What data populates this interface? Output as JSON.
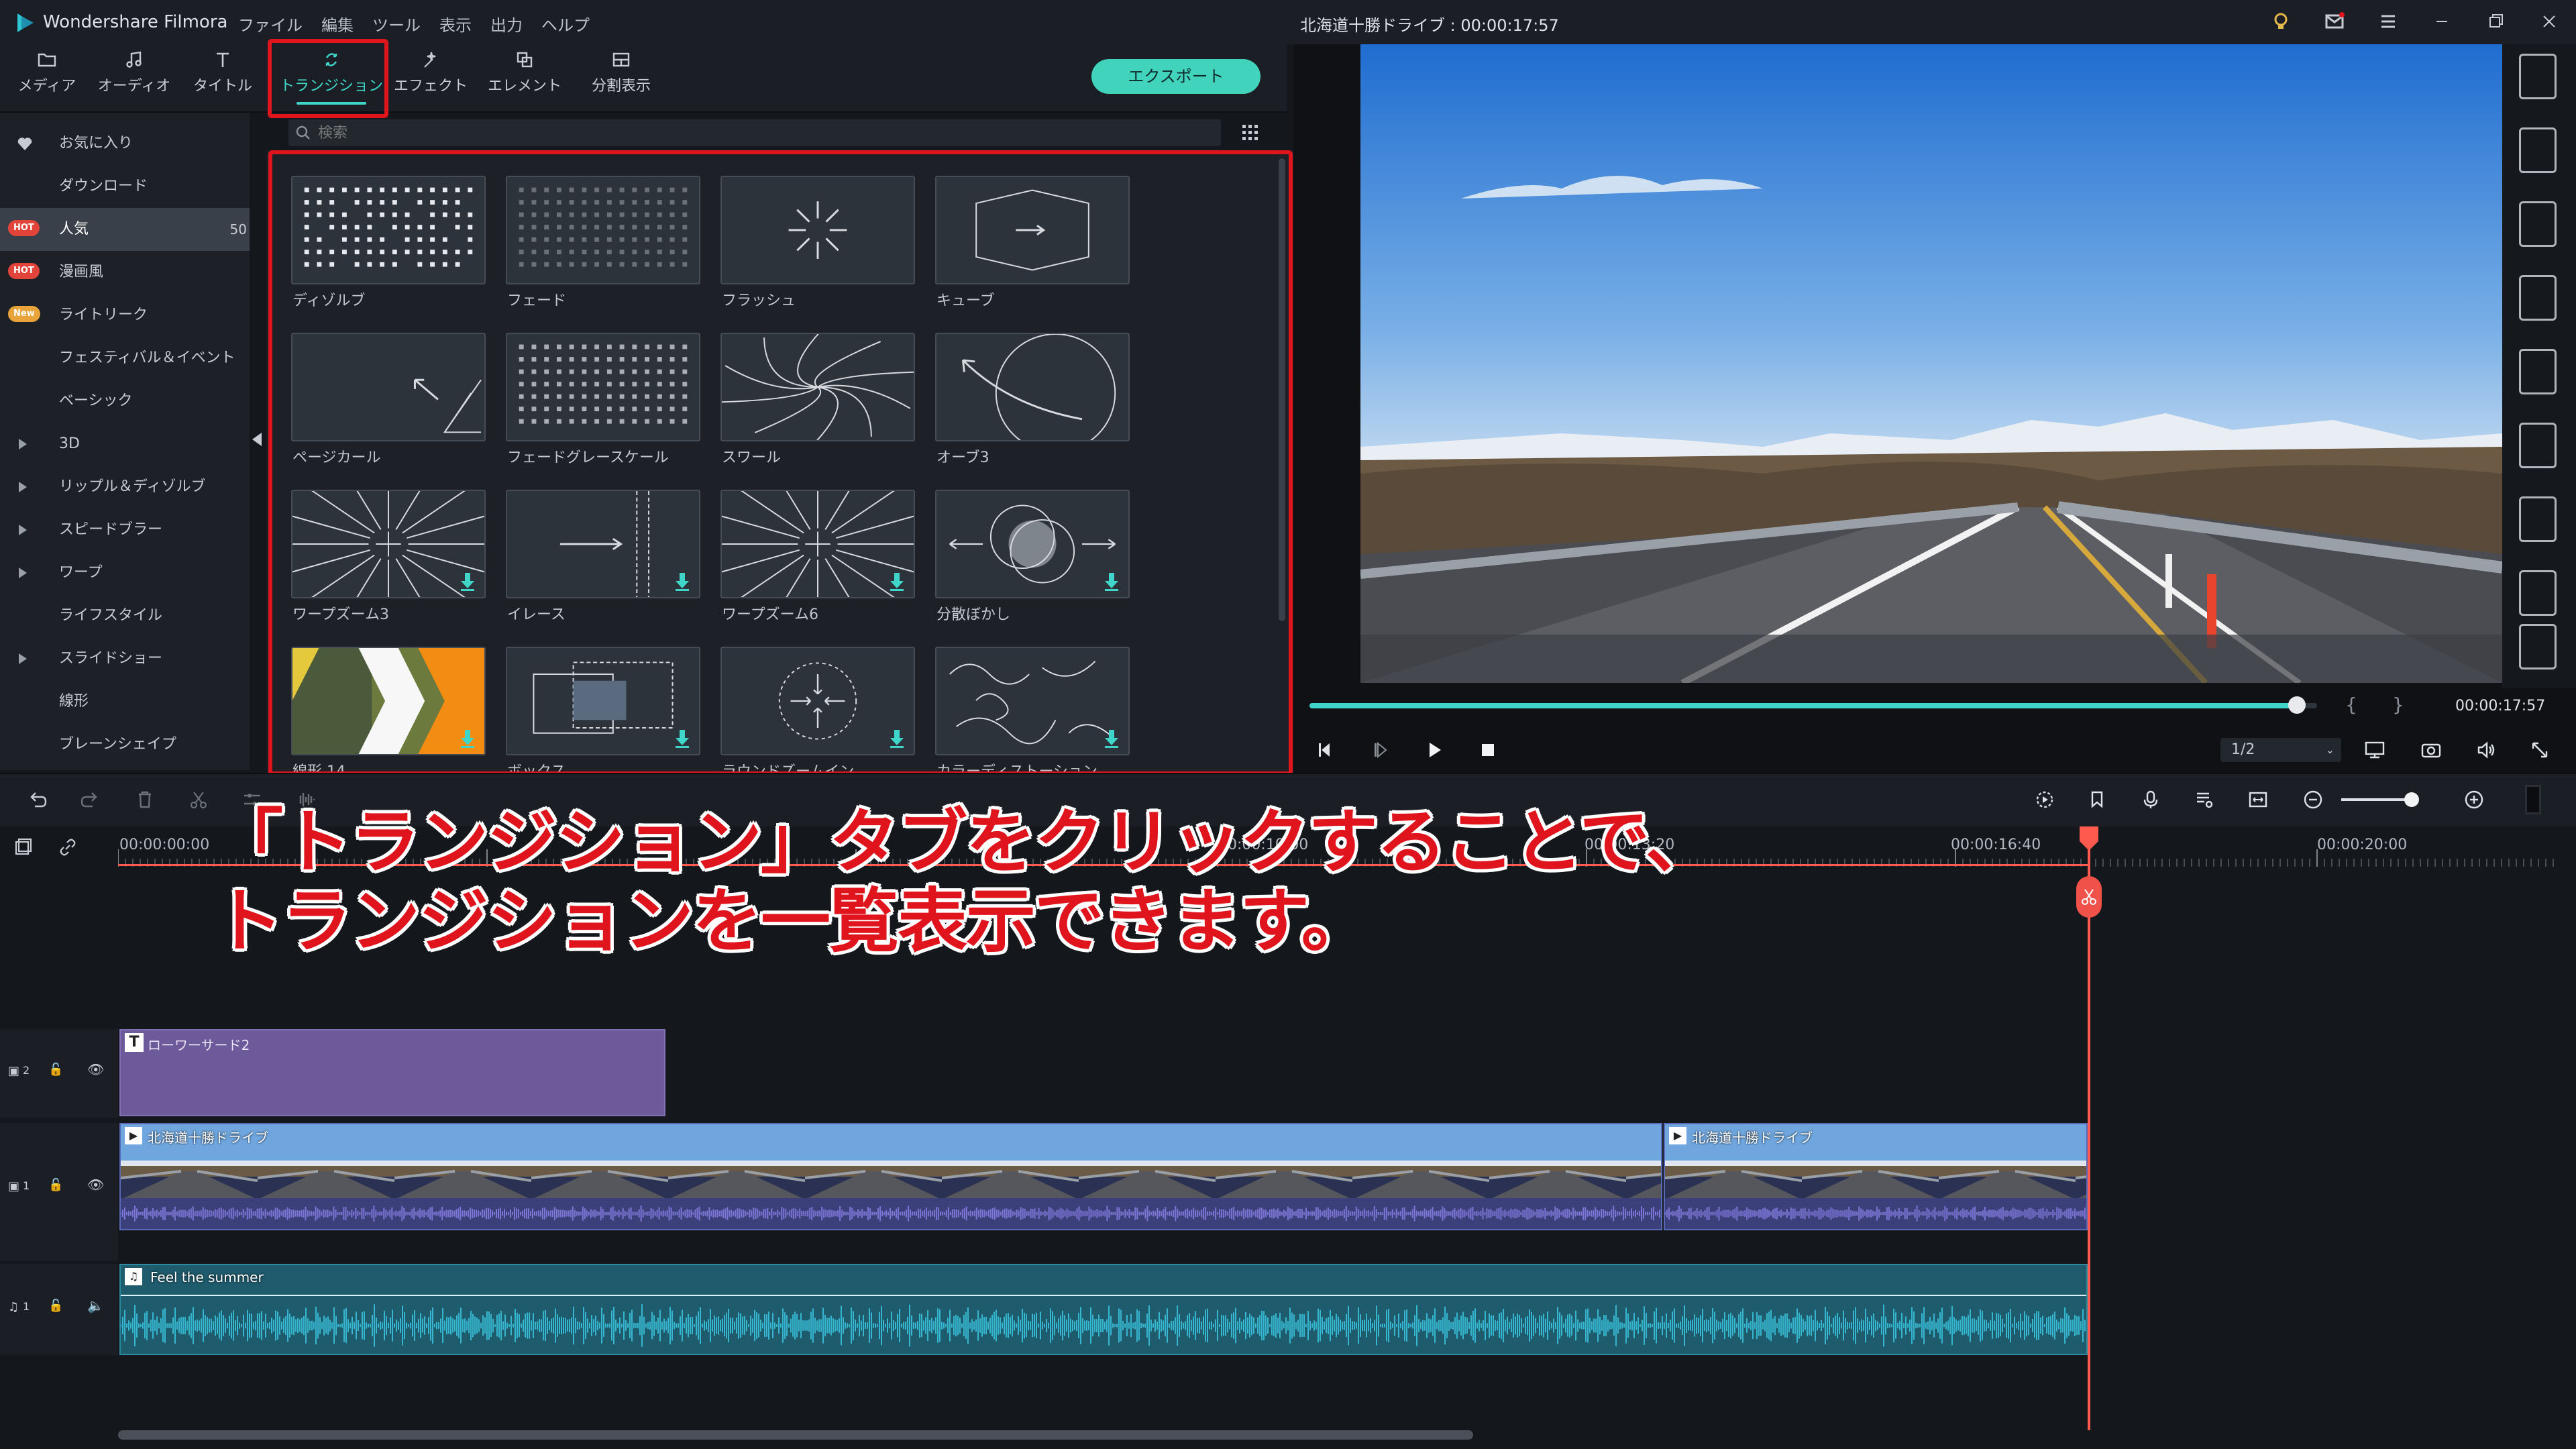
{
  "app": {
    "name": "Wondershare Filmora",
    "menu": [
      "ファイル",
      "編集",
      "ツール",
      "表示",
      "出力",
      "ヘルプ"
    ],
    "document_title": "北海道十勝ドライブ : 00:00:17:57"
  },
  "toolbar": {
    "tabs": [
      {
        "label": "メディア",
        "icon": "folder-icon"
      },
      {
        "label": "オーディオ",
        "icon": "music-note-icon"
      },
      {
        "label": "タイトル",
        "icon": "text-t-icon"
      },
      {
        "label": "トランジション",
        "icon": "transition-icon",
        "active": true
      },
      {
        "label": "エフェクト",
        "icon": "magic-icon"
      },
      {
        "label": "エレメント",
        "icon": "element-icon"
      },
      {
        "label": "分割表示",
        "icon": "split-screen-icon"
      }
    ],
    "export_label": "エクスポート",
    "accent_color": "#3fd5c8",
    "export_color": "#42d3bd"
  },
  "sidebar": {
    "items": [
      {
        "label": "お気に入り",
        "icon": "heart-icon"
      },
      {
        "label": "ダウンロード"
      },
      {
        "label": "人気",
        "badge": "HOT",
        "selected": true,
        "count": "50"
      },
      {
        "label": "漫画風",
        "badge": "HOT"
      },
      {
        "label": "ライトリーク",
        "badge": "New"
      },
      {
        "label": "フェスティバル＆イベント"
      },
      {
        "label": "ベーシック"
      },
      {
        "label": "3D",
        "expandable": true
      },
      {
        "label": "リップル＆ディゾルブ",
        "expandable": true
      },
      {
        "label": "スピードブラー",
        "expandable": true
      },
      {
        "label": "ワープ",
        "expandable": true
      },
      {
        "label": "ライフスタイル"
      },
      {
        "label": "スライドショー",
        "expandable": true
      },
      {
        "label": "線形"
      },
      {
        "label": "ブレーンシェイプ"
      }
    ]
  },
  "search": {
    "placeholder": "検索"
  },
  "transitions": [
    {
      "name": "ディゾルブ",
      "pattern": "dissolve"
    },
    {
      "name": "フェード",
      "pattern": "fade"
    },
    {
      "name": "フラッシュ",
      "pattern": "flash"
    },
    {
      "name": "キューブ",
      "pattern": "cube"
    },
    {
      "name": "ページカール",
      "pattern": "pagecurl"
    },
    {
      "name": "フェードグレースケール",
      "pattern": "fadegray"
    },
    {
      "name": "スワール",
      "pattern": "swirl"
    },
    {
      "name": "オーブ3",
      "pattern": "orb"
    },
    {
      "name": "ワープズーム3",
      "pattern": "warpzoom",
      "download": true
    },
    {
      "name": "イレース",
      "pattern": "erase",
      "download": true
    },
    {
      "name": "ワープズーム6",
      "pattern": "warpzoom6",
      "download": true
    },
    {
      "name": "分散ぼかし",
      "pattern": "scatter",
      "download": true
    },
    {
      "name": "線形 14",
      "pattern": "chevron",
      "download": true
    },
    {
      "name": "ボックス",
      "pattern": "box",
      "download": true
    },
    {
      "name": "ラウンドズームイン",
      "pattern": "roundzoom",
      "download": true
    },
    {
      "name": "カラーディストーション",
      "pattern": "colorwave",
      "download": true
    }
  ],
  "player": {
    "timecode": "00:00:17:57",
    "progress": 0.98,
    "quality": "1/2",
    "accent_color": "#3fd5c8"
  },
  "timeline": {
    "ruler_labels": [
      "00:00:00:00",
      "00:00:06:20",
      "00:00:10:00",
      "00:00:13:20",
      "00:00:16:40",
      "00:00:20:00"
    ],
    "tracks": [
      {
        "id": "title-track",
        "label": "2"
      },
      {
        "id": "video-track",
        "label": "1"
      },
      {
        "id": "audio-track",
        "label": "1"
      }
    ],
    "title_clip": "ローワーサード2",
    "video_clips": [
      "北海道十勝ドライブ",
      "北海道十勝ドライブ"
    ],
    "audio_clip": "Feel the summer",
    "playhead_color": "#ff5a4d"
  },
  "annotation": {
    "line1": "「トランジション」タブをクリックすることで、",
    "line2": "トランジションを一覧表示できます。",
    "color": "#e0141c"
  }
}
